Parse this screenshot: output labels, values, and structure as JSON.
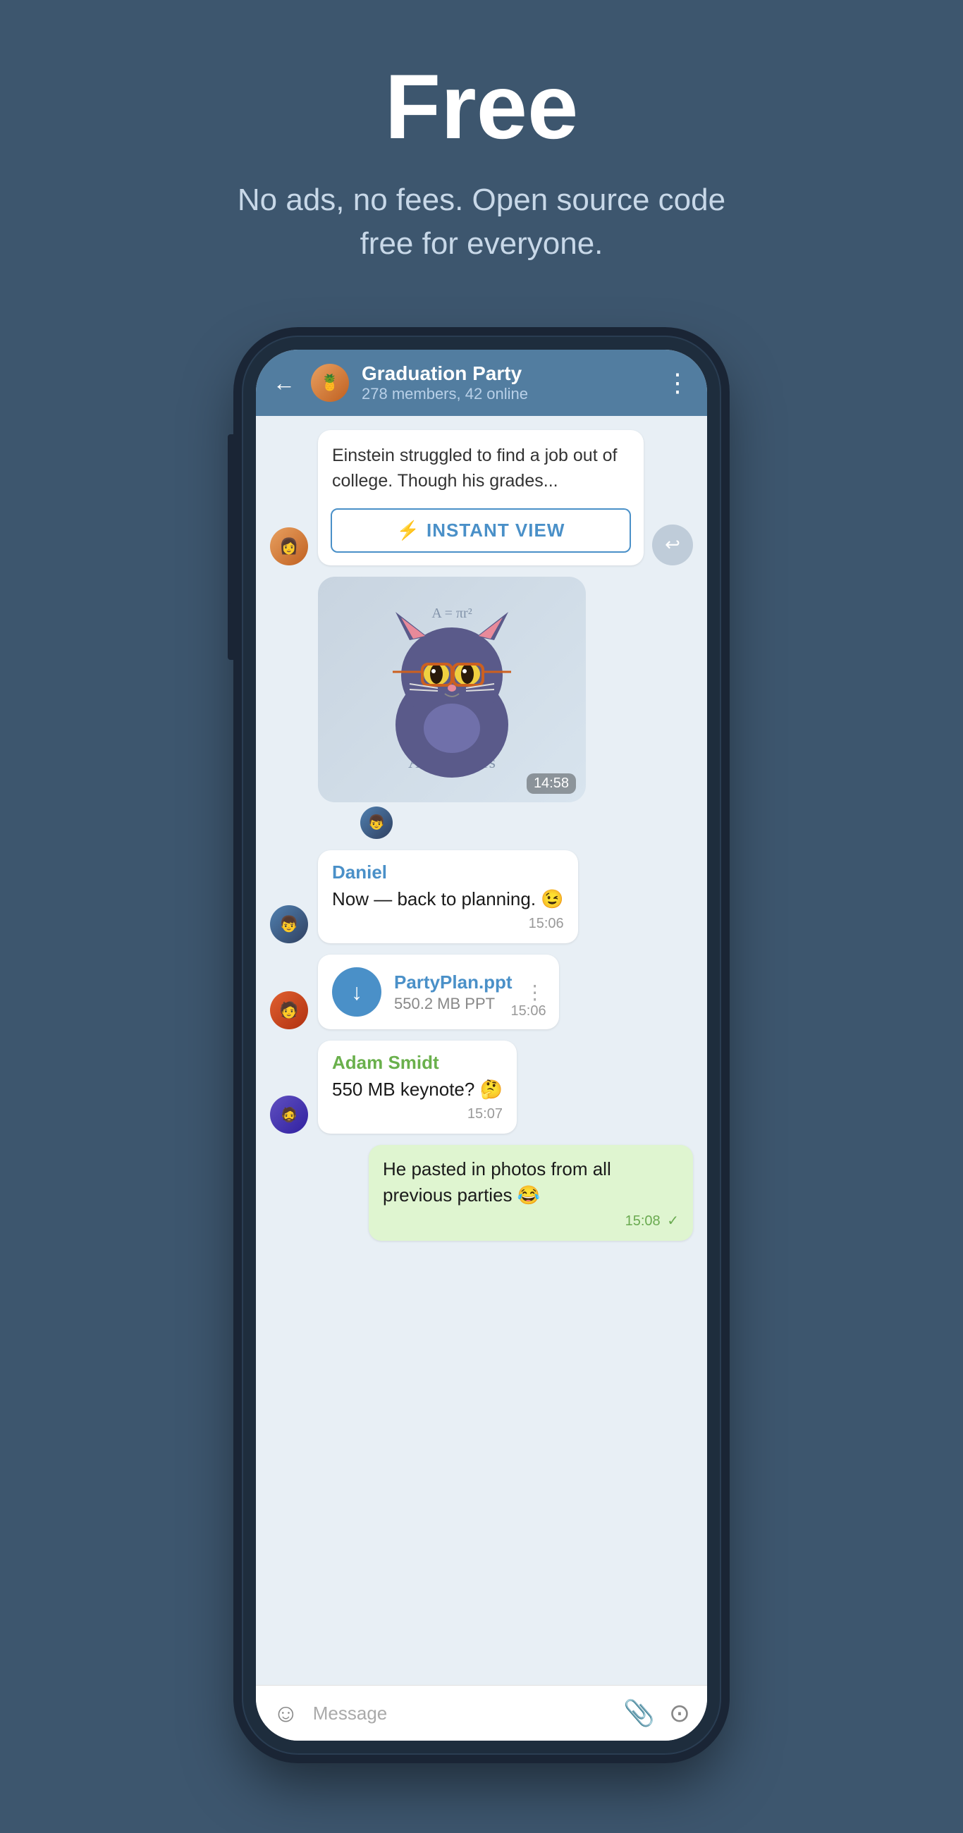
{
  "hero": {
    "title": "Free",
    "subtitle": "No ads, no fees. Open source code free for everyone."
  },
  "chat": {
    "group_name": "Graduation Party",
    "group_meta": "278 members, 42 online",
    "back_label": "←",
    "more_label": "⋮"
  },
  "article": {
    "text": "Einstein struggled to find a job out of college. Though his grades...",
    "instant_view_label": "INSTANT VIEW"
  },
  "sticker": {
    "time": "14:58"
  },
  "messages": [
    {
      "sender": "Daniel",
      "sender_color": "daniel",
      "text": "Now — back to planning. 😉",
      "time": "15:06"
    },
    {
      "sender": null,
      "file_name": "PartyPlan.ppt",
      "file_size": "550.2 MB PPT",
      "time": "15:06"
    },
    {
      "sender": "Adam Smidt",
      "sender_color": "adam",
      "text": "550 MB keynote? 🤔",
      "time": "15:07"
    },
    {
      "sender": null,
      "text": "He pasted in photos from all previous parties 😂",
      "time": "15:08",
      "is_own": true
    }
  ],
  "input_placeholder": "Message",
  "icons": {
    "bolt": "⚡",
    "back": "←",
    "more": "⋮",
    "download": "↓",
    "emoji": "☺",
    "attachment": "📎",
    "camera": "⊙",
    "forward": "↩",
    "check": "✓"
  }
}
